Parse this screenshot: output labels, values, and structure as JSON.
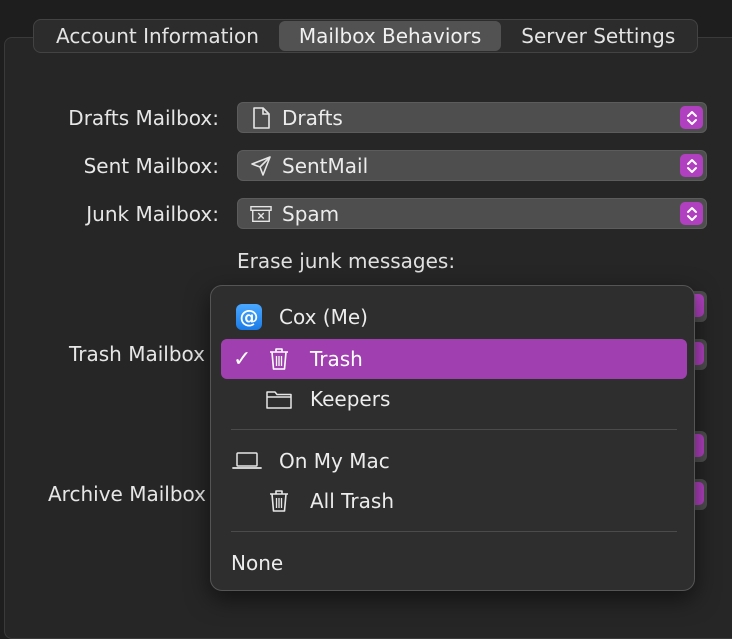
{
  "tabs": [
    {
      "label": "Account Information",
      "active": false
    },
    {
      "label": "Mailbox Behaviors",
      "active": true
    },
    {
      "label": "Server Settings",
      "active": false
    }
  ],
  "form": {
    "drafts": {
      "label": "Drafts Mailbox:",
      "value": "Drafts",
      "icon": "document-icon"
    },
    "sent": {
      "label": "Sent Mailbox:",
      "value": "SentMail",
      "icon": "paper-plane-icon"
    },
    "junk": {
      "label": "Junk Mailbox:",
      "value": "Spam",
      "icon": "junk-box-icon"
    },
    "erase_junk_label": "Erase junk messages:",
    "trash_label": "Trash Mailbox",
    "archive_label": "Archive Mailbox"
  },
  "menu": {
    "groups": [
      {
        "account": "Cox (Me)",
        "icon": "at-sign-icon",
        "items": [
          {
            "label": "Trash",
            "icon": "trash-icon",
            "selected": true
          },
          {
            "label": "Keepers",
            "icon": "folder-icon",
            "selected": false
          }
        ]
      },
      {
        "account": "On My Mac",
        "icon": "laptop-icon",
        "items": [
          {
            "label": "All Trash",
            "icon": "trash-icon",
            "selected": false
          }
        ]
      }
    ],
    "none_label": "None",
    "check_glyph": "✓"
  },
  "colors": {
    "accent": "#a040b0",
    "stepper": "#b140c1"
  }
}
